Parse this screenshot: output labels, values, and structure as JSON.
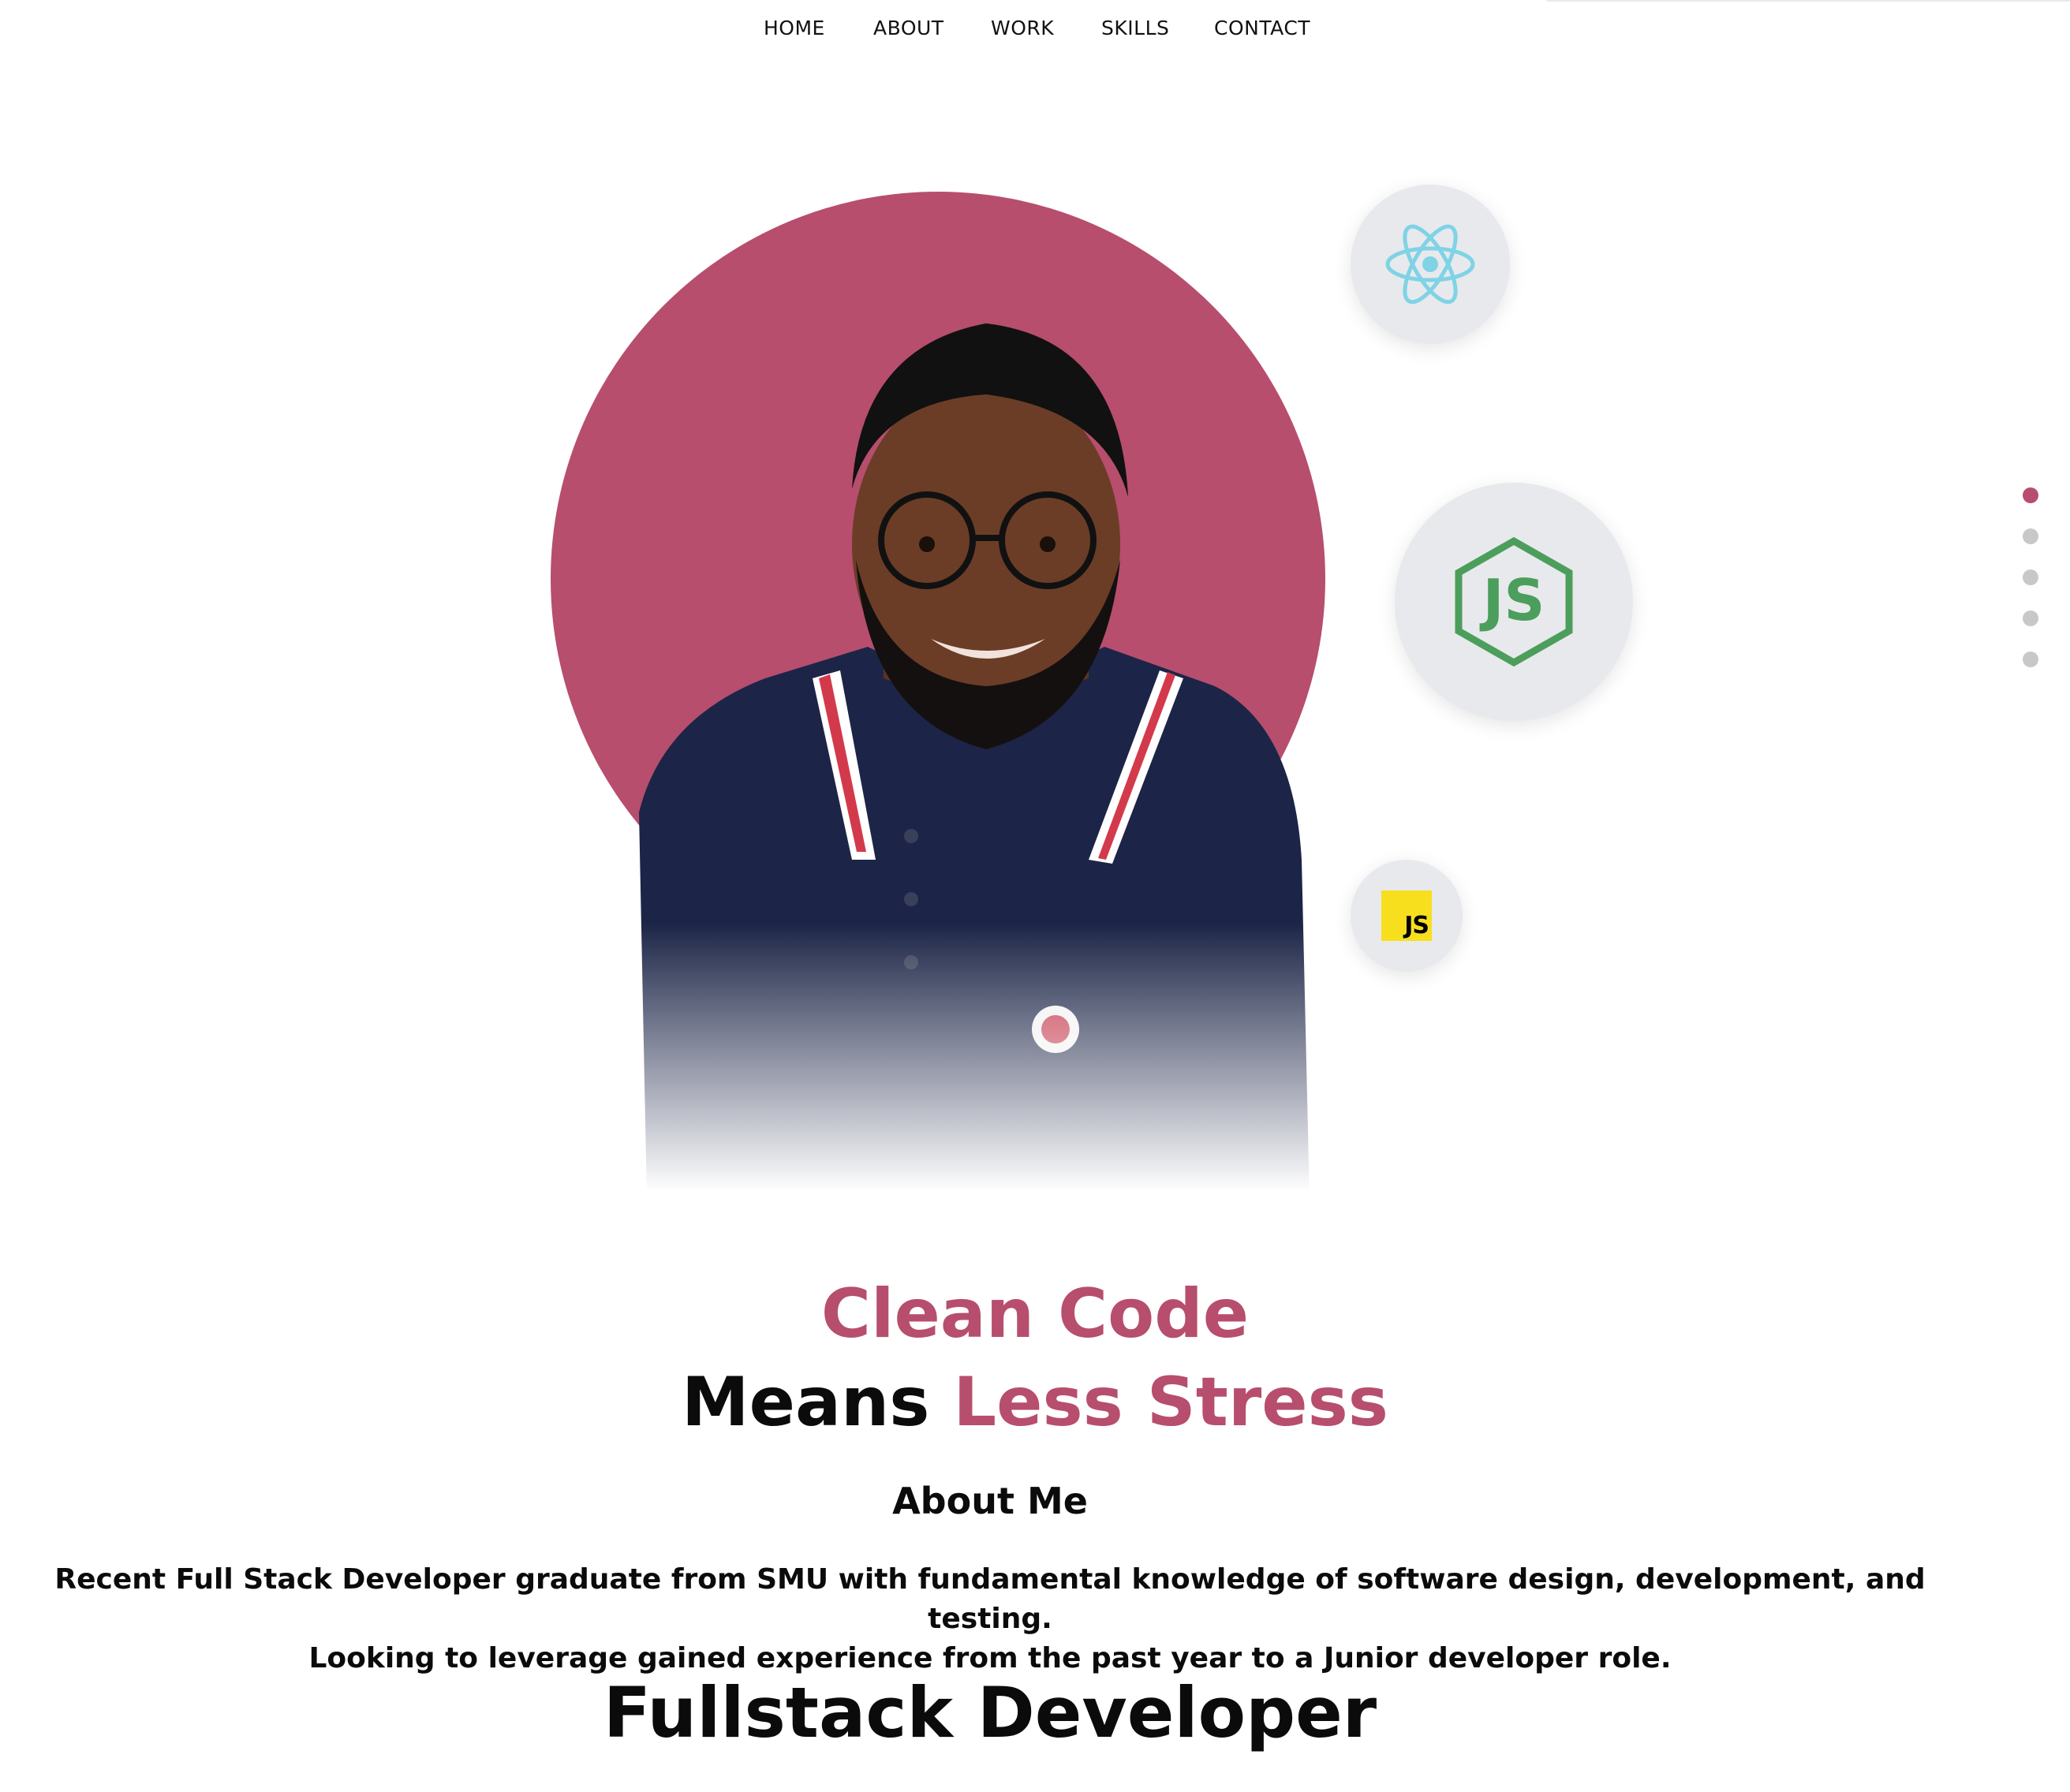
{
  "nav": {
    "items": [
      "HOME",
      "ABOUT",
      "WORK",
      "SKILLS",
      "CONTACT"
    ]
  },
  "hero": {
    "photo_alt": "Portrait of smiling man with glasses and beard wearing a navy polo",
    "accent_color": "#b74e6e",
    "skill_icons": [
      "react-icon",
      "nodejs-icon",
      "javascript-icon"
    ],
    "js_tile_label": "JS"
  },
  "headline": {
    "line1": "Clean Code",
    "line2_part1": "Means",
    "line2_part2": "Less Stress"
  },
  "about": {
    "title": "About Me",
    "line1": "Recent Full Stack Developer graduate from SMU with fundamental knowledge of software design, development, and testing.",
    "line2": "Looking to leverage gained experience from the past year to a Junior developer role."
  },
  "role": "Fullstack Developer",
  "section_dots": {
    "count": 5,
    "active_index": 0
  }
}
